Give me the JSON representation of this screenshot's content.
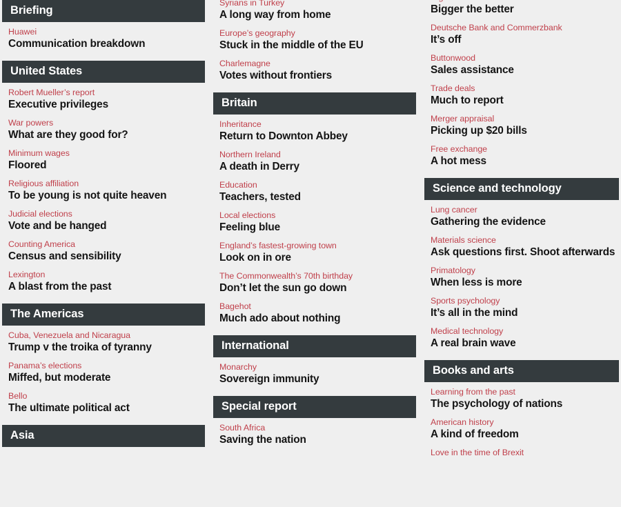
{
  "theme": {
    "page_background": "#efefef",
    "section_header_background": "#343b3e",
    "section_header_text": "#ffffff",
    "kicker_color": "#c0404b",
    "headline_color": "#141414"
  },
  "columns": [
    {
      "id": "column-1",
      "sections": [
        {
          "header": "Briefing",
          "has_header": true,
          "articles": [
            {
              "kicker": "Huawei",
              "headline": "Communication breakdown"
            }
          ]
        },
        {
          "header": "United States",
          "has_header": true,
          "articles": [
            {
              "kicker": "Robert Mueller’s report",
              "headline": "Executive privileges"
            },
            {
              "kicker": "War powers",
              "headline": "What are they good for?"
            },
            {
              "kicker": "Minimum wages",
              "headline": "Floored"
            },
            {
              "kicker": "Religious affiliation",
              "headline": "To be young is not quite heaven"
            },
            {
              "kicker": "Judicial elections",
              "headline": "Vote and be hanged"
            },
            {
              "kicker": "Counting America",
              "headline": "Census and sensibility"
            },
            {
              "kicker": "Lexington",
              "headline": "A blast from the past"
            }
          ]
        },
        {
          "header": "The Americas",
          "has_header": true,
          "articles": [
            {
              "kicker": "Cuba, Venezuela and Nicaragua",
              "headline": "Trump v the troika of tyranny"
            },
            {
              "kicker": "Panama’s elections",
              "headline": "Miffed, but moderate"
            },
            {
              "kicker": "Bello",
              "headline": "The ultimate political act"
            }
          ]
        },
        {
          "header": "Asia",
          "has_header": true,
          "articles": []
        }
      ]
    },
    {
      "id": "column-2",
      "sections": [
        {
          "header": "",
          "has_header": false,
          "articles": [
            {
              "kicker": "Syrians in Turkey",
              "headline": "A long way from home"
            },
            {
              "kicker": "Europe’s geography",
              "headline": "Stuck in the middle of the EU"
            },
            {
              "kicker": "Charlemagne",
              "headline": "Votes without frontiers"
            }
          ]
        },
        {
          "header": "Britain",
          "has_header": true,
          "articles": [
            {
              "kicker": "Inheritance",
              "headline": "Return to Downton Abbey"
            },
            {
              "kicker": "Northern Ireland",
              "headline": "A death in Derry"
            },
            {
              "kicker": "Education",
              "headline": "Teachers, tested"
            },
            {
              "kicker": "Local elections",
              "headline": "Feeling blue"
            },
            {
              "kicker": "England’s fastest-growing town",
              "headline": "Look on in ore"
            },
            {
              "kicker": "The Commonwealth’s 70th birthday",
              "headline": "Don’t let the sun go down"
            },
            {
              "kicker": "Bagehot",
              "headline": "Much ado about nothing"
            }
          ]
        },
        {
          "header": "International",
          "has_header": true,
          "articles": [
            {
              "kicker": "Monarchy",
              "headline": "Sovereign immunity"
            }
          ]
        },
        {
          "header": "Special report",
          "has_header": true,
          "articles": [
            {
              "kicker": "South Africa",
              "headline": "Saving the nation"
            }
          ]
        }
      ]
    },
    {
      "id": "column-3",
      "sections": [
        {
          "header": "",
          "has_header": false,
          "articles": [
            {
              "kicker": "Nigerian banks",
              "headline": "Bigger the better"
            },
            {
              "kicker": "Deutsche Bank and Commerzbank",
              "headline": "It’s off"
            },
            {
              "kicker": "Buttonwood",
              "headline": "Sales assistance"
            },
            {
              "kicker": "Trade deals",
              "headline": "Much to report"
            },
            {
              "kicker": "Merger appraisal",
              "headline": "Picking up $20 bills"
            },
            {
              "kicker": "Free exchange",
              "headline": "A hot mess"
            }
          ]
        },
        {
          "header": "Science and technology",
          "has_header": true,
          "articles": [
            {
              "kicker": "Lung cancer",
              "headline": "Gathering the evidence"
            },
            {
              "kicker": "Materials science",
              "headline": "Ask questions first. Shoot afterwards"
            },
            {
              "kicker": "Primatology",
              "headline": "When less is more"
            },
            {
              "kicker": "Sports psychology",
              "headline": "It’s all in the mind"
            },
            {
              "kicker": "Medical technology",
              "headline": "A real brain wave"
            }
          ]
        },
        {
          "header": "Books and arts",
          "has_header": true,
          "articles": [
            {
              "kicker": "Learning from the past",
              "headline": "The psychology of nations"
            },
            {
              "kicker": "American history",
              "headline": "A kind of freedom"
            },
            {
              "kicker": "Love in the time of Brexit",
              "headline": ""
            }
          ]
        }
      ]
    }
  ]
}
